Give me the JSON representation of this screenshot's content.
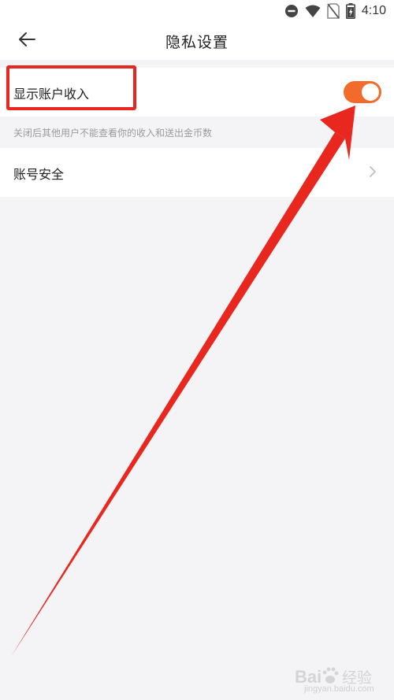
{
  "status_bar": {
    "time": "4:10",
    "icons": [
      "do-not-disturb-icon",
      "wifi-icon",
      "no-sim-icon",
      "battery-charging-icon"
    ]
  },
  "header": {
    "title": "隐私设置",
    "back_icon": "arrow-left-icon"
  },
  "settings": {
    "show_income": {
      "label": "显示账户收入",
      "enabled": true
    },
    "hint": "关闭后其他用户不能查看你的收入和送出金币数",
    "account_security": {
      "label": "账号安全",
      "icon": "chevron-right-icon"
    }
  },
  "colors": {
    "toggle_on": "#f26b2b",
    "annotation": "#e8271f",
    "background": "#f4f4f6"
  },
  "watermark": {
    "brand": "Bai  经验",
    "sub": "jingyan.baidu.com"
  }
}
